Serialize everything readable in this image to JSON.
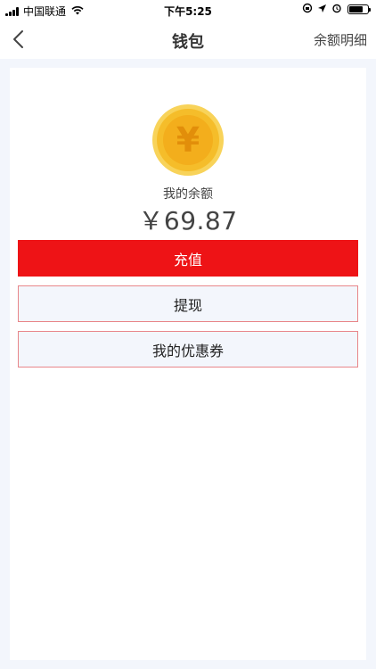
{
  "status_bar": {
    "carrier": "中国联通",
    "time": "下午5:25"
  },
  "nav": {
    "title": "钱包",
    "right_link": "余额明细"
  },
  "wallet": {
    "balance_label": "我的余额",
    "balance_amount": "￥69.87",
    "coin_symbol": "¥"
  },
  "actions": {
    "recharge": "充值",
    "withdraw": "提现",
    "coupons": "我的优惠券"
  },
  "colors": {
    "accent_red": "#ee1316",
    "coin_gold": "#f7c233"
  }
}
